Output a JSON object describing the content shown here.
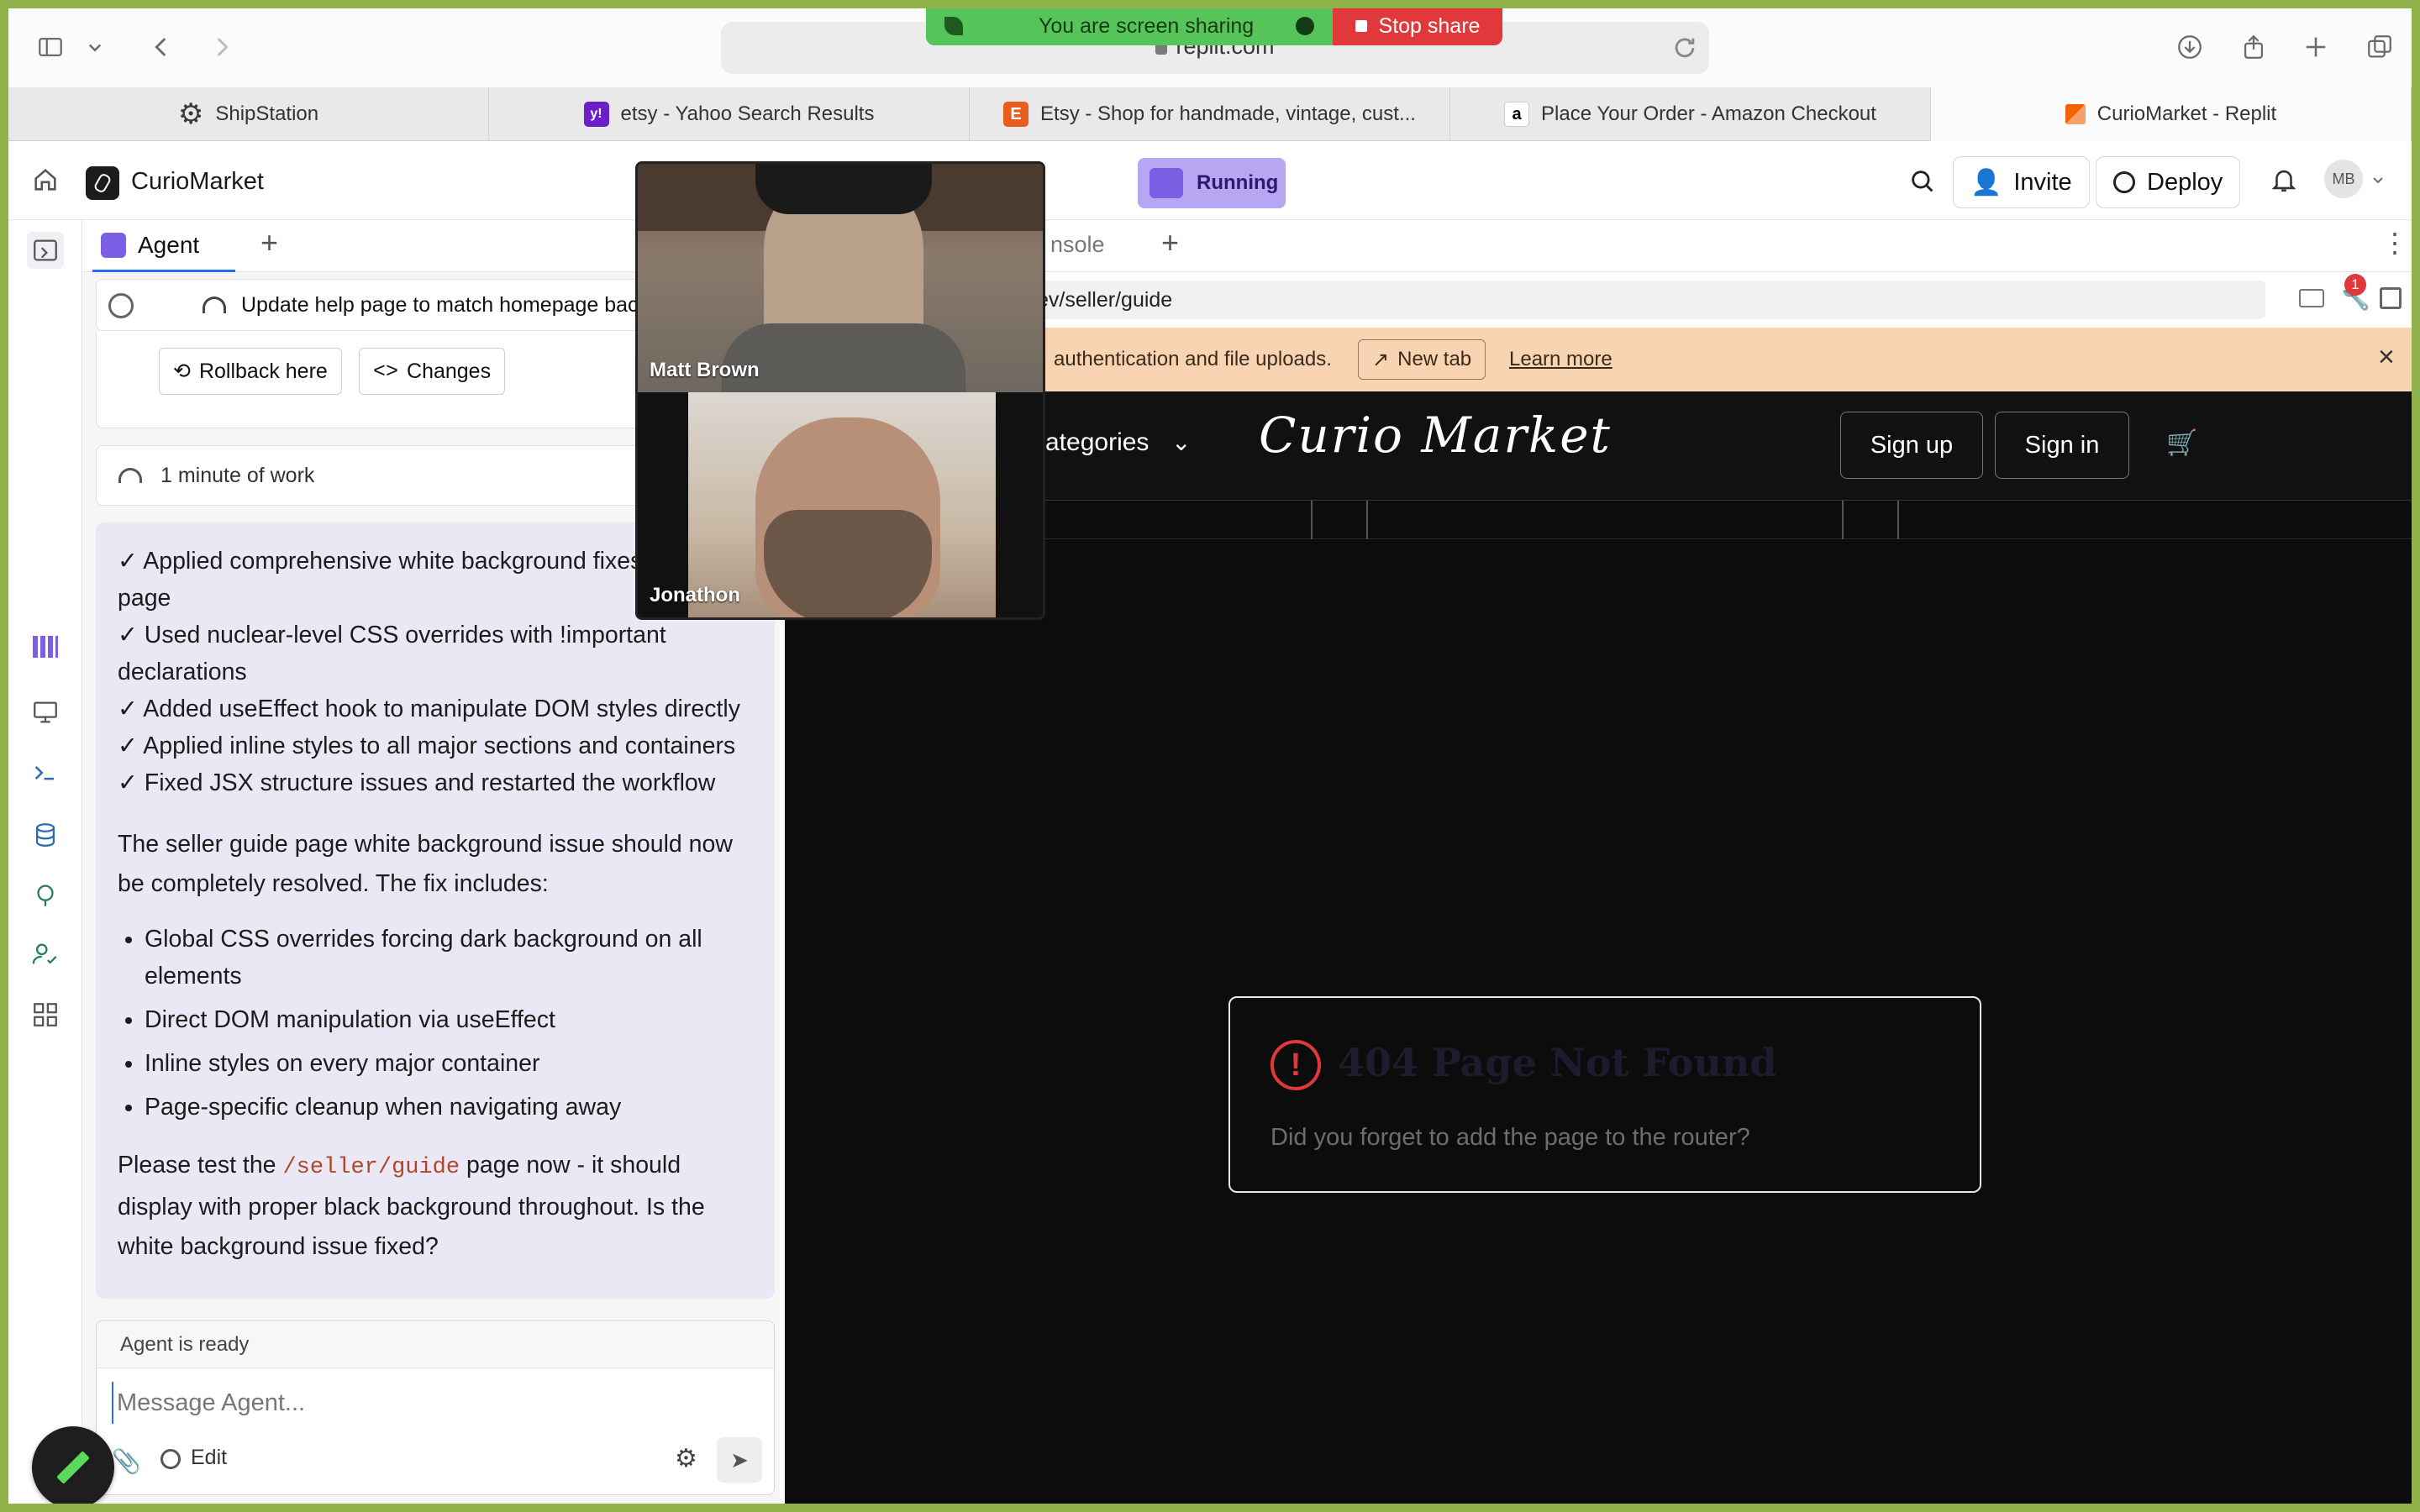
{
  "browser": {
    "url": "replit.com",
    "share": {
      "status": "You are screen sharing",
      "stop_label": "Stop share"
    },
    "tabs": [
      {
        "label": "ShipStation",
        "icon": "gear-icon"
      },
      {
        "label": "etsy - Yahoo Search Results",
        "icon": "yahoo-icon",
        "icon_text": "y!"
      },
      {
        "label": "Etsy - Shop for handmade, vintage, cust...",
        "icon": "etsy-icon",
        "icon_text": "E"
      },
      {
        "label": "Place Your Order - Amazon Checkout",
        "icon": "amazon-icon",
        "icon_text": "a"
      },
      {
        "label": "CurioMarket - Replit",
        "icon": "replit-icon"
      }
    ]
  },
  "header": {
    "project_name": "CurioMarket",
    "run_status": "Running",
    "invite_label": "Invite",
    "deploy_label": "Deploy",
    "avatar_initials": "MB"
  },
  "agent": {
    "tab_label": "Agent",
    "checkpoint_title": "Update help page to match homepage back",
    "rollback_label": "Rollback here",
    "changes_label": "Changes",
    "work_time": "1 minute of work",
    "checks": [
      "✓ Applied comprehensive white background fixes to guide page",
      "✓ Used nuclear-level CSS overrides with !important declarations",
      "✓ Added useEffect hook to manipulate DOM styles directly",
      "✓ Applied inline styles to all major sections and containers",
      "✓ Fixed JSX structure issues and restarted the workflow"
    ],
    "summary": "The seller guide page white background issue should now be completely resolved. The fix includes:",
    "bullets": [
      "Global CSS overrides forcing dark background on all elements",
      "Direct DOM manipulation via useEffect",
      "Inline styles on every major container",
      "Page-specific cleanup when navigating away"
    ],
    "closing_pre": "Please test the ",
    "closing_code": "/seller/guide",
    "closing_post": " page now - it should display with proper black background throughout. Is the white background issue fixed?",
    "status": "Agent is ready",
    "input_placeholder": "Message Agent...",
    "edit_label": "Edit"
  },
  "webview": {
    "tab_partial": "nsole",
    "url_partial": "ev/seller/guide",
    "banner_text": "authentication and file uploads.",
    "new_tab_label": "New tab",
    "learn_more_label": "Learn more",
    "badge_count": "1",
    "site": {
      "categories_partial": "ategories",
      "brand": "Curio Market",
      "signup_label": "Sign up",
      "signin_label": "Sign in",
      "error_title": "404 Page Not Found",
      "error_message": "Did you forget to add the page to the router?"
    }
  },
  "video_call": {
    "participants": [
      {
        "name": "Matt Brown"
      },
      {
        "name": "Jonathon"
      }
    ]
  }
}
